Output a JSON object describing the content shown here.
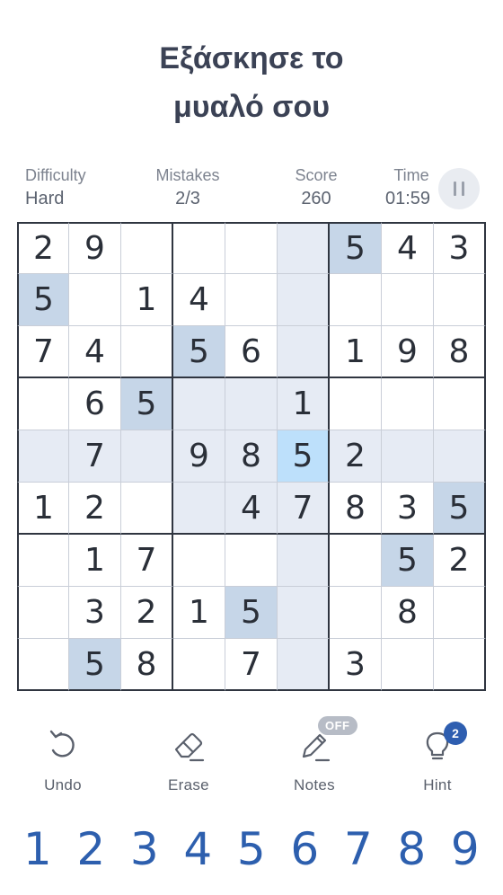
{
  "title": {
    "line1": "Εξάσκησε το",
    "line2": "μυαλό σου"
  },
  "stats": {
    "difficulty": {
      "label": "Difficulty",
      "value": "Hard"
    },
    "mistakes": {
      "label": "Mistakes",
      "value": "2/3"
    },
    "score": {
      "label": "Score",
      "value": "260"
    },
    "time": {
      "label": "Time",
      "value": "01:59"
    }
  },
  "board": {
    "cells": [
      [
        "2",
        "9",
        "",
        "",
        "",
        "",
        "5",
        "4",
        "3"
      ],
      [
        "5",
        "",
        "1",
        "4",
        "",
        "",
        "",
        "",
        ""
      ],
      [
        "7",
        "4",
        "",
        "5",
        "6",
        "",
        "1",
        "9",
        "8"
      ],
      [
        "",
        "6",
        "5",
        "",
        "",
        "1",
        "",
        "",
        ""
      ],
      [
        "",
        "7",
        "",
        "9",
        "8",
        "5",
        "2",
        "",
        ""
      ],
      [
        "1",
        "2",
        "",
        "",
        "4",
        "7",
        "8",
        "3",
        "5"
      ],
      [
        "",
        "1",
        "7",
        "",
        "",
        "",
        "",
        "5",
        "2"
      ],
      [
        "",
        "3",
        "2",
        "1",
        "5",
        "",
        "",
        "8",
        ""
      ],
      [
        "",
        "5",
        "8",
        "",
        "7",
        "",
        "3",
        "",
        ""
      ]
    ],
    "selected": {
      "row": 4,
      "col": 5
    },
    "highlight_digit": "5",
    "colors": {
      "line": "#e6ebf4",
      "same_digit": "#c6d6e8",
      "selected": "#bde0fb"
    }
  },
  "tools": {
    "undo": {
      "label": "Undo",
      "icon": "undo-icon"
    },
    "erase": {
      "label": "Erase",
      "icon": "eraser-icon"
    },
    "notes": {
      "label": "Notes",
      "icon": "pencil-icon",
      "badge": "OFF"
    },
    "hint": {
      "label": "Hint",
      "icon": "lightbulb-icon",
      "badge": "2"
    }
  },
  "numpad": [
    "1",
    "2",
    "3",
    "4",
    "5",
    "6",
    "7",
    "8",
    "9"
  ],
  "colors": {
    "accent": "#2d5fae",
    "grid_bold": "#2f3540",
    "grid_thin": "#c9ced8"
  }
}
